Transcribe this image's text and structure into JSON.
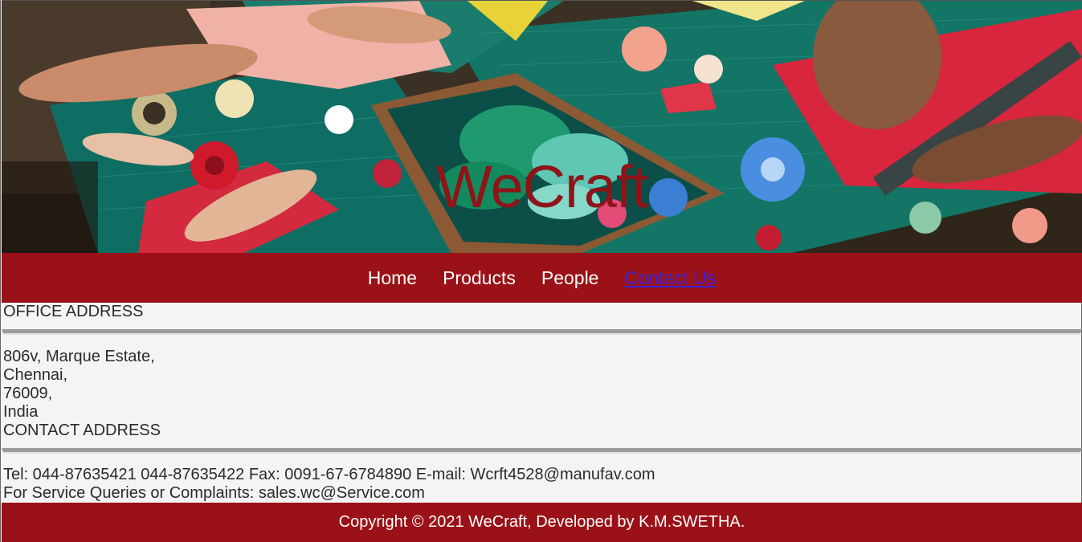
{
  "hero": {
    "title": "WeCraft",
    "image": "paper-craft-table-photo"
  },
  "nav": {
    "items": [
      {
        "label": "Home"
      },
      {
        "label": "Products"
      },
      {
        "label": "People"
      },
      {
        "label": "Contact Us",
        "active": true
      }
    ]
  },
  "office": {
    "heading": "OFFICE ADDRESS",
    "lines": [
      "806v, Marque Estate,",
      "Chennai,",
      "76009,",
      "India"
    ]
  },
  "contact": {
    "heading": "CONTACT ADDRESS",
    "phones_line": "Tel: 044-87635421 044-87635422 Fax: 0091-67-6784890 E-mail: Wcrft4528@manufav.com",
    "service_line": "For Service Queries or Complaints: sales.wc@Service.com"
  },
  "footer": {
    "text": "Copyright © 2021 WeCraft, Developed by K.M.SWETHA."
  },
  "colors": {
    "brand_red": "#9a1117",
    "title_red": "#8e1418",
    "link_active": "#3b22d8",
    "page_bg": "#f4f4f4"
  }
}
